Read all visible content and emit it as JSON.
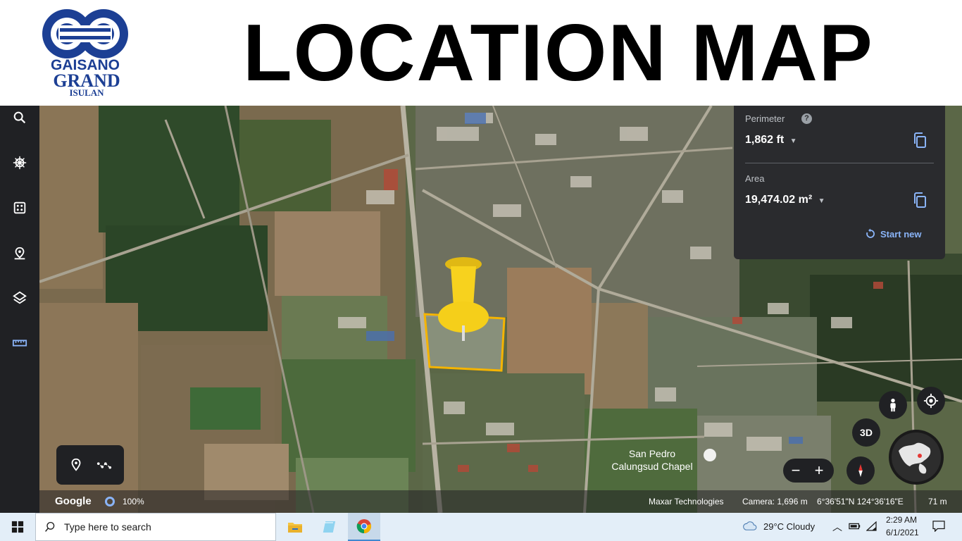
{
  "header": {
    "title": "LOCATION MAP",
    "logo": {
      "line1": "GAISANO",
      "line2": "GRAND",
      "line3": "ISULAN"
    }
  },
  "toolbar": {
    "items": [
      {
        "icon": "search-icon"
      },
      {
        "icon": "voyager-wheel-icon"
      },
      {
        "icon": "feeling-lucky-dice-icon"
      },
      {
        "icon": "projects-pin-icon"
      },
      {
        "icon": "map-style-layers-icon"
      },
      {
        "icon": "measure-ruler-icon"
      }
    ]
  },
  "measure": {
    "perimeter_label": "Perimeter",
    "perimeter_value": "1,862 ft",
    "area_label": "Area",
    "area_value": "19,474.02 m²",
    "start_new": "Start new",
    "help": "?"
  },
  "map": {
    "place_label_line1": "San Pedro",
    "place_label_line2": "Calungsud Chapel",
    "btn_3d": "3D"
  },
  "status": {
    "brand": "Google",
    "zoom": "100%",
    "attribution": "Maxar Technologies",
    "camera": "Camera: 1,696 m",
    "coords": "6°36'51\"N 124°36'16\"E",
    "scale": "71 m"
  },
  "taskbar": {
    "search_placeholder": "Type here to search",
    "weather": "29°C  Cloudy",
    "time": "2:29 AM",
    "date": "6/1/2021"
  },
  "colors": {
    "polygon_stroke": "#f5b400",
    "pin": "#f7d21e",
    "accent": "#8ab4f8",
    "panel_bg": "#2a2b2e"
  }
}
